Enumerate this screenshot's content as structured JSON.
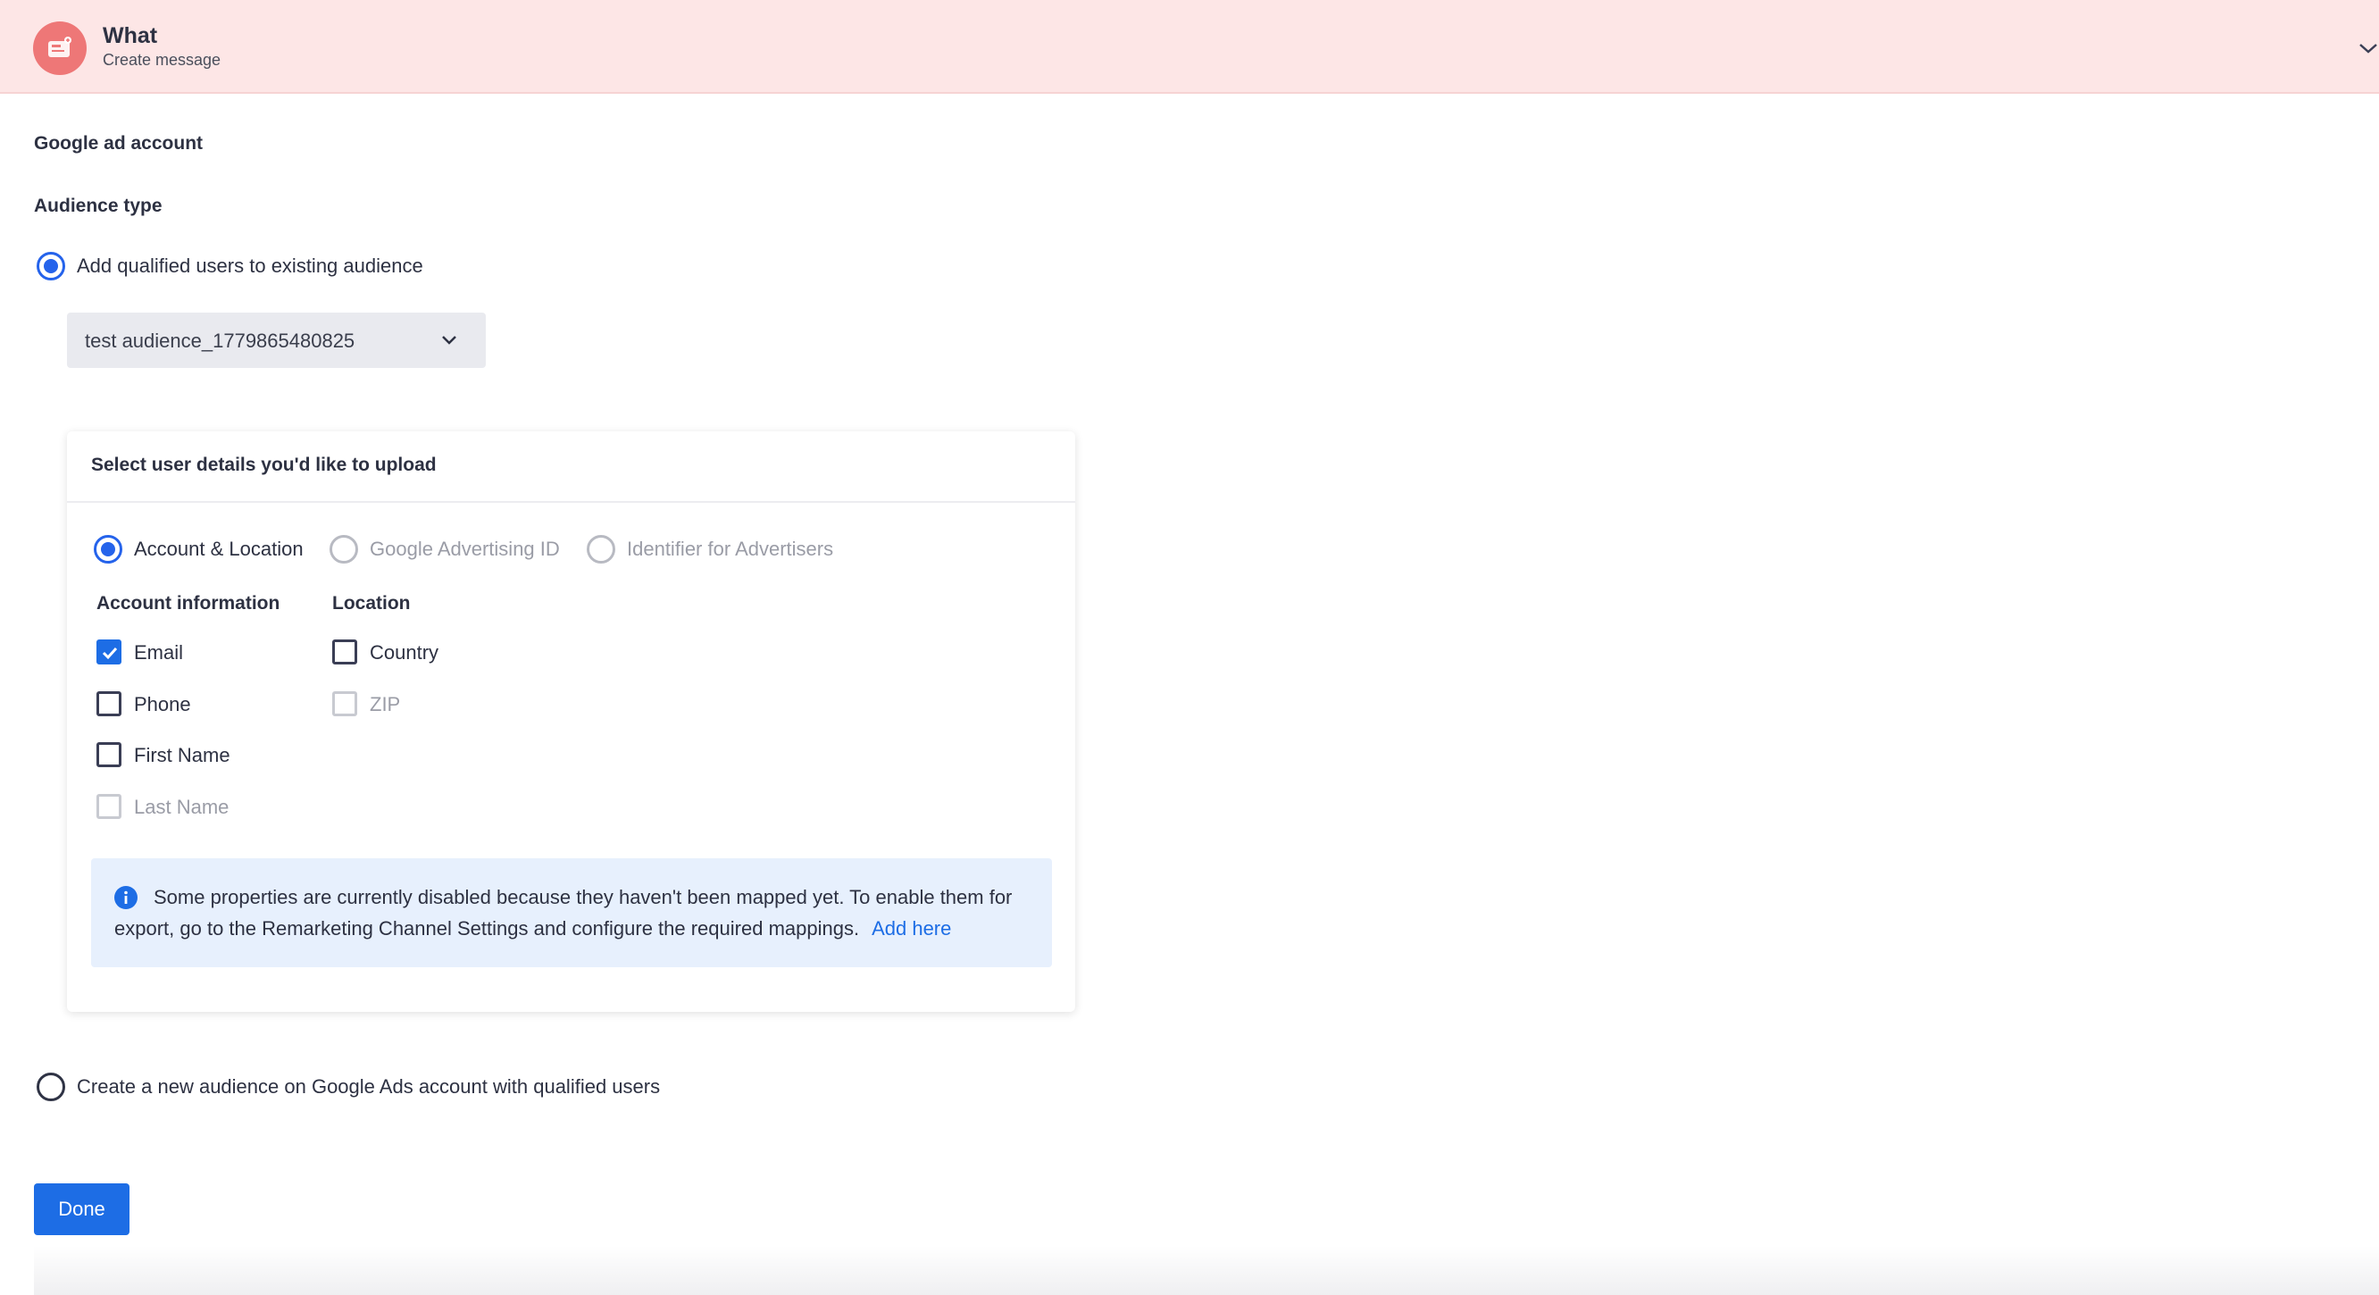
{
  "header": {
    "title": "What",
    "subtitle": "Create message",
    "icon": "campaign-icon",
    "bg_color": "#fde6e6"
  },
  "google_ad_account_label": "Google ad account",
  "audience_type_label": "Audience type",
  "option_existing": {
    "label": "Add qualified users to existing audience",
    "selected": true
  },
  "audience_dropdown": {
    "value": "test audience_1779865480825"
  },
  "panel": {
    "title": "Select user details you'd like to upload",
    "id_types": [
      {
        "label": "Account & Location",
        "selected": true,
        "disabled": false
      },
      {
        "label": "Google Advertising ID",
        "selected": false,
        "disabled": true
      },
      {
        "label": "Identifier for Advertisers",
        "selected": false,
        "disabled": true
      }
    ],
    "account_info": {
      "heading": "Account information",
      "fields": [
        {
          "label": "Email",
          "checked": true,
          "disabled": false
        },
        {
          "label": "Phone",
          "checked": false,
          "disabled": false
        },
        {
          "label": "First Name",
          "checked": false,
          "disabled": false
        },
        {
          "label": "Last Name",
          "checked": false,
          "disabled": true
        }
      ]
    },
    "location": {
      "heading": "Location",
      "fields": [
        {
          "label": "Country",
          "checked": false,
          "disabled": false
        },
        {
          "label": "ZIP",
          "checked": false,
          "disabled": true
        }
      ]
    },
    "info": {
      "text": "Some properties are currently disabled because they haven't been mapped yet. To enable them for export, go to the Remarketing Channel Settings and configure the required mappings.",
      "link": "Add here"
    }
  },
  "option_new": {
    "label": "Create a new audience on Google Ads account with qualified users",
    "selected": false
  },
  "done_button": "Done",
  "colors": {
    "accent": "#1d6de5",
    "info_bg": "#e7f0fd"
  }
}
